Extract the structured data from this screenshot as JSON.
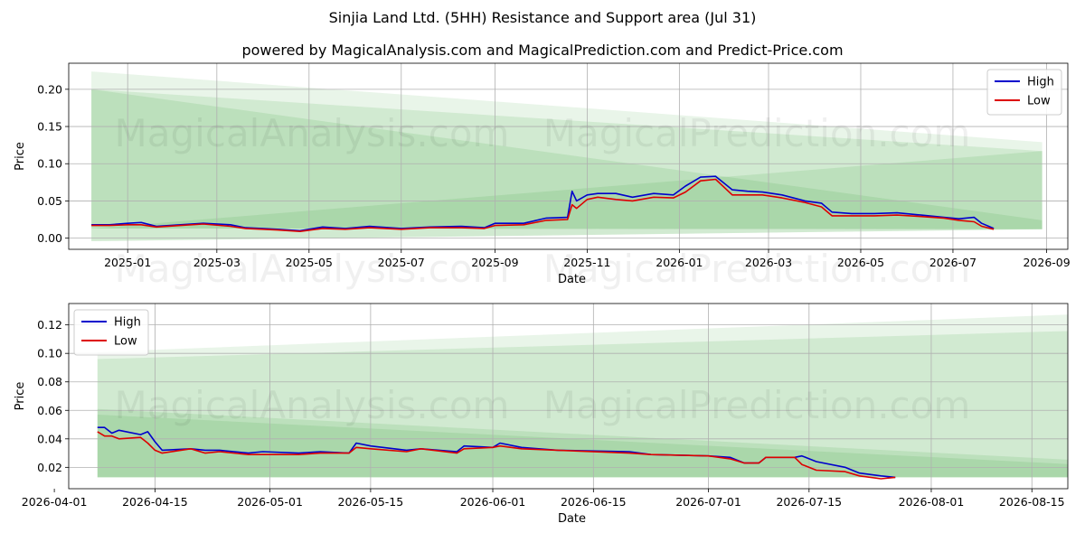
{
  "title": "Sinjia Land Ltd. (5HH) Resistance and Support area (Jul 31)",
  "subtitle": "powered by MagicalAnalysis.com and MagicalPrediction.com and Predict-Price.com",
  "watermark": [
    "MagicalAnalysis.com",
    "MagicalPrediction.com"
  ],
  "colors": {
    "high": "#0000cc",
    "low": "#dd0000",
    "band": "#2ca02c"
  },
  "chart_data": [
    {
      "type": "line",
      "xlabel": "Date",
      "ylabel": "Price",
      "xlim": [
        "2024-11-23",
        "2026-09-15"
      ],
      "ylim": [
        -0.015,
        0.235
      ],
      "xticks": [
        {
          "date": "2025-01-01",
          "label": "2025-01"
        },
        {
          "date": "2025-03-01",
          "label": "2025-03"
        },
        {
          "date": "2025-05-01",
          "label": "2025-05"
        },
        {
          "date": "2025-07-01",
          "label": "2025-07"
        },
        {
          "date": "2025-09-01",
          "label": "2025-09"
        },
        {
          "date": "2025-11-01",
          "label": "2025-11"
        },
        {
          "date": "2026-01-01",
          "label": "2026-01"
        },
        {
          "date": "2026-03-01",
          "label": "2026-03"
        },
        {
          "date": "2026-05-01",
          "label": "2026-05"
        },
        {
          "date": "2026-07-01",
          "label": "2026-07"
        },
        {
          "date": "2026-09-01",
          "label": "2026-09"
        }
      ],
      "yticks": [
        {
          "value": 0.0,
          "label": "0.00"
        },
        {
          "value": 0.05,
          "label": "0.05"
        },
        {
          "value": 0.1,
          "label": "0.10"
        },
        {
          "value": 0.15,
          "label": "0.15"
        },
        {
          "value": 0.2,
          "label": "0.20"
        }
      ],
      "grid": true,
      "legend": "upper right",
      "bands": [
        {
          "x": [
            "2024-12-08",
            "2026-08-29"
          ],
          "upper": [
            0.224,
            0.129
          ],
          "lower": [
            -0.004,
            0.012
          ],
          "opacity": 0.1
        },
        {
          "x": [
            "2024-12-08",
            "2026-08-29"
          ],
          "upper": [
            0.2,
            0.117
          ],
          "lower": [
            -0.004,
            0.012
          ],
          "opacity": 0.12
        },
        {
          "x": [
            "2024-12-08",
            "2026-08-29"
          ],
          "upper": [
            0.2,
            0.024
          ],
          "lower": [
            0.013,
            0.012
          ],
          "opacity": 0.12
        },
        {
          "x": [
            "2024-12-08",
            "2026-08-29"
          ],
          "upper": [
            0.013,
            0.117
          ],
          "lower": [
            0.013,
            0.012
          ],
          "opacity": 0.12
        }
      ],
      "series": [
        {
          "name": "High",
          "color": "#0000cc",
          "points": [
            [
              "2024-12-08",
              0.018
            ],
            [
              "2024-12-20",
              0.018
            ],
            [
              "2025-01-01",
              0.02
            ],
            [
              "2025-01-10",
              0.021
            ],
            [
              "2025-01-20",
              0.016
            ],
            [
              "2025-02-05",
              0.018
            ],
            [
              "2025-02-20",
              0.02
            ],
            [
              "2025-03-10",
              0.018
            ],
            [
              "2025-03-20",
              0.014
            ],
            [
              "2025-04-10",
              0.012
            ],
            [
              "2025-04-25",
              0.01
            ],
            [
              "2025-05-10",
              0.015
            ],
            [
              "2025-05-25",
              0.013
            ],
            [
              "2025-06-10",
              0.016
            ],
            [
              "2025-07-01",
              0.013
            ],
            [
              "2025-07-20",
              0.015
            ],
            [
              "2025-08-10",
              0.016
            ],
            [
              "2025-08-25",
              0.014
            ],
            [
              "2025-09-01",
              0.02
            ],
            [
              "2025-09-20",
              0.02
            ],
            [
              "2025-10-05",
              0.027
            ],
            [
              "2025-10-19",
              0.028
            ],
            [
              "2025-10-22",
              0.063
            ],
            [
              "2025-10-25",
              0.05
            ],
            [
              "2025-11-01",
              0.058
            ],
            [
              "2025-11-08",
              0.06
            ],
            [
              "2025-11-20",
              0.06
            ],
            [
              "2025-12-01",
              0.055
            ],
            [
              "2025-12-15",
              0.06
            ],
            [
              "2025-12-28",
              0.058
            ],
            [
              "2026-01-05",
              0.07
            ],
            [
              "2026-01-15",
              0.082
            ],
            [
              "2026-01-25",
              0.083
            ],
            [
              "2026-02-05",
              0.065
            ],
            [
              "2026-02-15",
              0.063
            ],
            [
              "2026-02-25",
              0.062
            ],
            [
              "2026-03-10",
              0.058
            ],
            [
              "2026-03-25",
              0.05
            ],
            [
              "2026-04-05",
              0.047
            ],
            [
              "2026-04-12",
              0.035
            ],
            [
              "2026-04-25",
              0.033
            ],
            [
              "2026-05-10",
              0.033
            ],
            [
              "2026-05-25",
              0.034
            ],
            [
              "2026-06-10",
              0.031
            ],
            [
              "2026-06-25",
              0.028
            ],
            [
              "2026-07-05",
              0.026
            ],
            [
              "2026-07-15",
              0.028
            ],
            [
              "2026-07-20",
              0.02
            ],
            [
              "2026-07-28",
              0.013
            ]
          ]
        },
        {
          "name": "Low",
          "color": "#dd0000",
          "points": [
            [
              "2024-12-08",
              0.017
            ],
            [
              "2024-12-20",
              0.017
            ],
            [
              "2025-01-01",
              0.018
            ],
            [
              "2025-01-10",
              0.018
            ],
            [
              "2025-01-20",
              0.015
            ],
            [
              "2025-02-05",
              0.017
            ],
            [
              "2025-02-20",
              0.019
            ],
            [
              "2025-03-10",
              0.016
            ],
            [
              "2025-03-20",
              0.013
            ],
            [
              "2025-04-10",
              0.011
            ],
            [
              "2025-04-25",
              0.009
            ],
            [
              "2025-05-10",
              0.013
            ],
            [
              "2025-05-25",
              0.012
            ],
            [
              "2025-06-10",
              0.014
            ],
            [
              "2025-07-01",
              0.012
            ],
            [
              "2025-07-20",
              0.014
            ],
            [
              "2025-08-10",
              0.014
            ],
            [
              "2025-08-25",
              0.013
            ],
            [
              "2025-09-01",
              0.017
            ],
            [
              "2025-09-20",
              0.018
            ],
            [
              "2025-10-05",
              0.024
            ],
            [
              "2025-10-19",
              0.025
            ],
            [
              "2025-10-22",
              0.045
            ],
            [
              "2025-10-25",
              0.04
            ],
            [
              "2025-11-01",
              0.052
            ],
            [
              "2025-11-08",
              0.055
            ],
            [
              "2025-11-20",
              0.052
            ],
            [
              "2025-12-01",
              0.05
            ],
            [
              "2025-12-15",
              0.055
            ],
            [
              "2025-12-28",
              0.054
            ],
            [
              "2026-01-05",
              0.062
            ],
            [
              "2026-01-15",
              0.077
            ],
            [
              "2026-01-25",
              0.079
            ],
            [
              "2026-02-05",
              0.058
            ],
            [
              "2026-02-15",
              0.058
            ],
            [
              "2026-02-25",
              0.058
            ],
            [
              "2026-03-10",
              0.054
            ],
            [
              "2026-03-25",
              0.048
            ],
            [
              "2026-04-05",
              0.042
            ],
            [
              "2026-04-12",
              0.03
            ],
            [
              "2026-04-25",
              0.03
            ],
            [
              "2026-05-10",
              0.03
            ],
            [
              "2026-05-25",
              0.031
            ],
            [
              "2026-06-10",
              0.029
            ],
            [
              "2026-06-25",
              0.027
            ],
            [
              "2026-07-05",
              0.024
            ],
            [
              "2026-07-15",
              0.022
            ],
            [
              "2026-07-20",
              0.016
            ],
            [
              "2026-07-28",
              0.012
            ]
          ]
        }
      ]
    },
    {
      "type": "line",
      "xlabel": "Date",
      "ylabel": "Price",
      "xlim": [
        "2026-04-03",
        "2026-08-20"
      ],
      "ylim": [
        0.005,
        0.135
      ],
      "xticks": [
        {
          "date": "2026-04-01",
          "label": "2026-04-01"
        },
        {
          "date": "2026-04-15",
          "label": "2026-04-15"
        },
        {
          "date": "2026-05-01",
          "label": "2026-05-01"
        },
        {
          "date": "2026-05-15",
          "label": "2026-05-15"
        },
        {
          "date": "2026-06-01",
          "label": "2026-06-01"
        },
        {
          "date": "2026-06-15",
          "label": "2026-06-15"
        },
        {
          "date": "2026-07-01",
          "label": "2026-07-01"
        },
        {
          "date": "2026-07-15",
          "label": "2026-07-15"
        },
        {
          "date": "2026-08-01",
          "label": "2026-08-01"
        },
        {
          "date": "2026-08-15",
          "label": "2026-08-15"
        }
      ],
      "yticks": [
        {
          "value": 0.02,
          "label": "0.02"
        },
        {
          "value": 0.04,
          "label": "0.04"
        },
        {
          "value": 0.06,
          "label": "0.06"
        },
        {
          "value": 0.08,
          "label": "0.08"
        },
        {
          "value": 0.1,
          "label": "0.10"
        },
        {
          "value": 0.12,
          "label": "0.12"
        }
      ],
      "grid": true,
      "legend": "upper left",
      "bands": [
        {
          "x": [
            "2026-04-07",
            "2026-08-29"
          ],
          "upper": [
            0.101,
            0.129
          ],
          "lower": [
            0.013,
            0.013
          ],
          "opacity": 0.1
        },
        {
          "x": [
            "2026-04-07",
            "2026-08-29"
          ],
          "upper": [
            0.096,
            0.117
          ],
          "lower": [
            0.013,
            0.013
          ],
          "opacity": 0.12
        },
        {
          "x": [
            "2026-04-07",
            "2026-08-29"
          ],
          "upper": [
            0.061,
            0.023
          ],
          "lower": [
            0.013,
            0.013
          ],
          "opacity": 0.12
        },
        {
          "x": [
            "2026-04-07",
            "2026-08-29"
          ],
          "upper": [
            0.057,
            0.02
          ],
          "lower": [
            0.013,
            0.013
          ],
          "opacity": 0.12
        }
      ],
      "series": [
        {
          "name": "High",
          "color": "#0000cc",
          "points": [
            [
              "2026-04-07",
              0.048
            ],
            [
              "2026-04-08",
              0.048
            ],
            [
              "2026-04-09",
              0.044
            ],
            [
              "2026-04-10",
              0.046
            ],
            [
              "2026-04-13",
              0.043
            ],
            [
              "2026-04-14",
              0.045
            ],
            [
              "2026-04-15",
              0.038
            ],
            [
              "2026-04-16",
              0.032
            ],
            [
              "2026-04-20",
              0.033
            ],
            [
              "2026-04-22",
              0.032
            ],
            [
              "2026-04-24",
              0.032
            ],
            [
              "2026-04-28",
              0.03
            ],
            [
              "2026-04-30",
              0.031
            ],
            [
              "2026-05-05",
              0.03
            ],
            [
              "2026-05-08",
              0.031
            ],
            [
              "2026-05-12",
              0.03
            ],
            [
              "2026-05-13",
              0.037
            ],
            [
              "2026-05-15",
              0.035
            ],
            [
              "2026-05-20",
              0.032
            ],
            [
              "2026-05-22",
              0.033
            ],
            [
              "2026-05-27",
              0.031
            ],
            [
              "2026-05-28",
              0.035
            ],
            [
              "2026-06-01",
              0.034
            ],
            [
              "2026-06-02",
              0.037
            ],
            [
              "2026-06-05",
              0.034
            ],
            [
              "2026-06-10",
              0.032
            ],
            [
              "2026-06-20",
              0.031
            ],
            [
              "2026-06-23",
              0.029
            ],
            [
              "2026-07-01",
              0.028
            ],
            [
              "2026-07-04",
              0.027
            ],
            [
              "2026-07-06",
              0.023
            ],
            [
              "2026-07-08",
              0.023
            ],
            [
              "2026-07-09",
              0.027
            ],
            [
              "2026-07-13",
              0.027
            ],
            [
              "2026-07-14",
              0.028
            ],
            [
              "2026-07-16",
              0.024
            ],
            [
              "2026-07-20",
              0.02
            ],
            [
              "2026-07-22",
              0.016
            ],
            [
              "2026-07-25",
              0.014
            ],
            [
              "2026-07-27",
              0.013
            ]
          ]
        },
        {
          "name": "Low",
          "color": "#dd0000",
          "points": [
            [
              "2026-04-07",
              0.045
            ],
            [
              "2026-04-08",
              0.042
            ],
            [
              "2026-04-09",
              0.042
            ],
            [
              "2026-04-10",
              0.04
            ],
            [
              "2026-04-13",
              0.041
            ],
            [
              "2026-04-14",
              0.037
            ],
            [
              "2026-04-15",
              0.032
            ],
            [
              "2026-04-16",
              0.03
            ],
            [
              "2026-04-20",
              0.033
            ],
            [
              "2026-04-22",
              0.03
            ],
            [
              "2026-04-24",
              0.031
            ],
            [
              "2026-04-28",
              0.029
            ],
            [
              "2026-04-30",
              0.029
            ],
            [
              "2026-05-05",
              0.029
            ],
            [
              "2026-05-08",
              0.03
            ],
            [
              "2026-05-12",
              0.03
            ],
            [
              "2026-05-13",
              0.034
            ],
            [
              "2026-05-15",
              0.033
            ],
            [
              "2026-05-20",
              0.031
            ],
            [
              "2026-05-22",
              0.033
            ],
            [
              "2026-05-27",
              0.03
            ],
            [
              "2026-05-28",
              0.033
            ],
            [
              "2026-06-01",
              0.034
            ],
            [
              "2026-06-02",
              0.035
            ],
            [
              "2026-06-05",
              0.033
            ],
            [
              "2026-06-10",
              0.032
            ],
            [
              "2026-06-20",
              0.03
            ],
            [
              "2026-06-23",
              0.029
            ],
            [
              "2026-07-01",
              0.028
            ],
            [
              "2026-07-04",
              0.026
            ],
            [
              "2026-07-06",
              0.023
            ],
            [
              "2026-07-08",
              0.023
            ],
            [
              "2026-07-09",
              0.027
            ],
            [
              "2026-07-13",
              0.027
            ],
            [
              "2026-07-14",
              0.022
            ],
            [
              "2026-07-16",
              0.018
            ],
            [
              "2026-07-20",
              0.017
            ],
            [
              "2026-07-22",
              0.014
            ],
            [
              "2026-07-25",
              0.012
            ],
            [
              "2026-07-27",
              0.013
            ]
          ]
        }
      ]
    }
  ]
}
